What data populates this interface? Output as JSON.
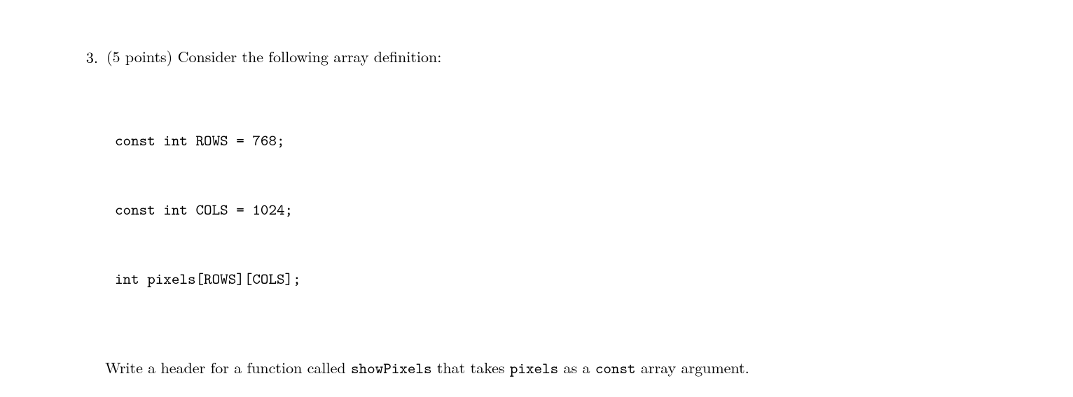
{
  "question": {
    "number": "3.",
    "points_text": "(5 points)",
    "intro_rest": " Consider the following array definition:",
    "code_lines": [
      "const int ROWS = 768;",
      "const int COLS = 1024;",
      "int pixels[ROWS][COLS];"
    ],
    "prompt": {
      "p1": "Write a header for a function called ",
      "fn": "showPixels",
      "p2": " that takes ",
      "arr": "pixels",
      "p3": " as a ",
      "kw": "const",
      "p4": " array argument."
    }
  }
}
